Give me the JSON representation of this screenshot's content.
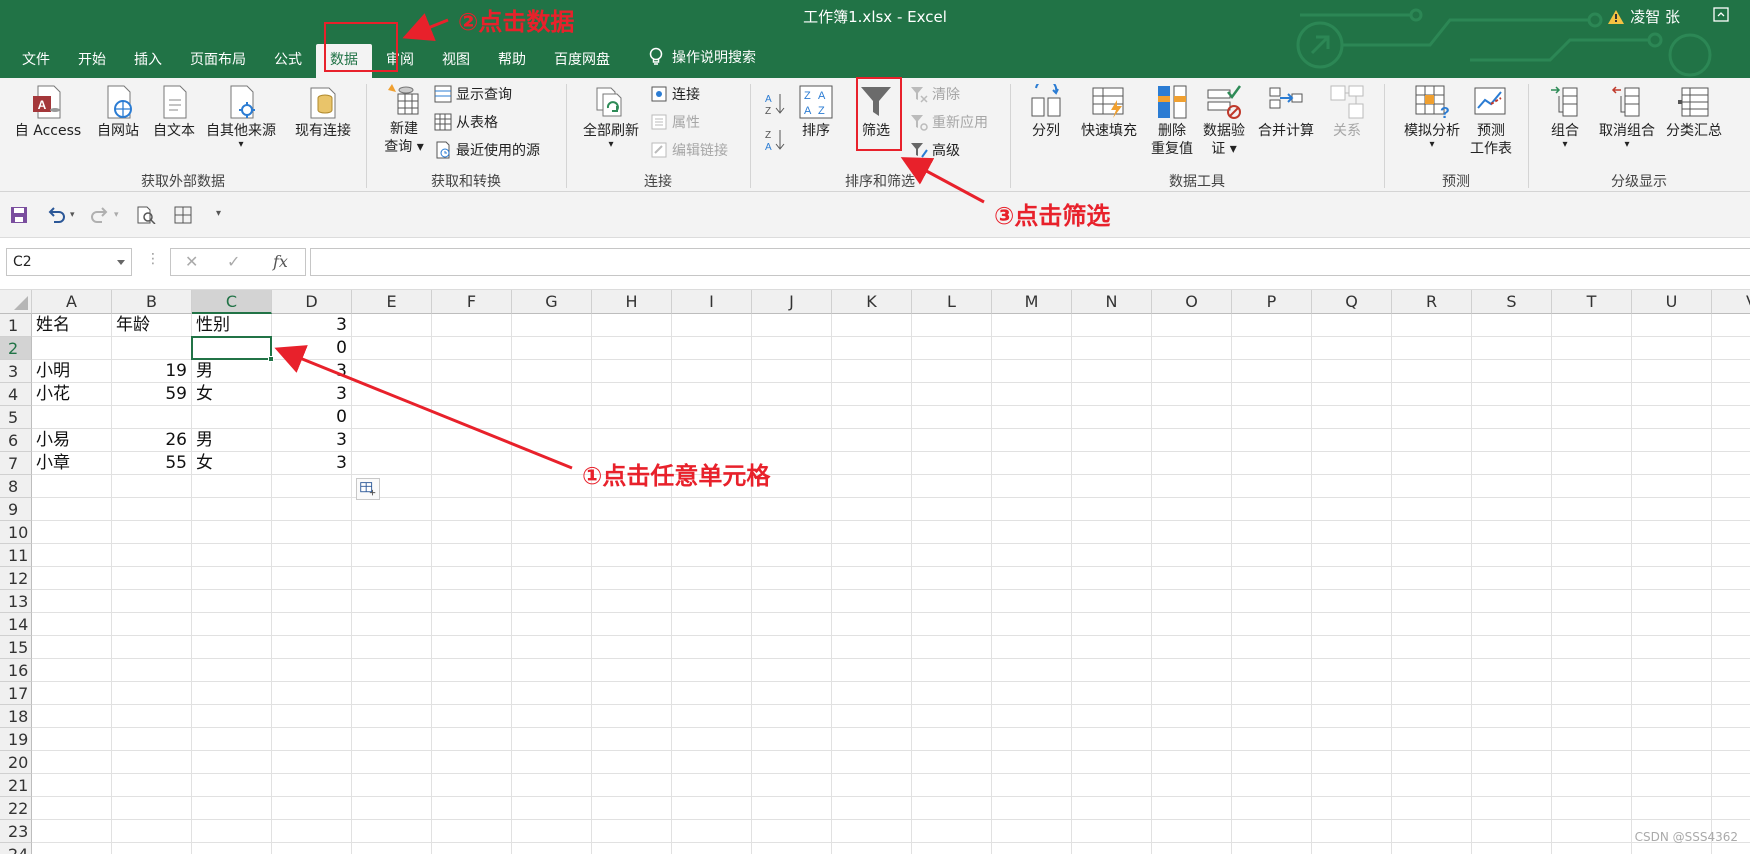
{
  "window": {
    "title": "工作簿1.xlsx  -  Excel",
    "user": "凌智 张"
  },
  "tabs": [
    {
      "label": "文件"
    },
    {
      "label": "开始"
    },
    {
      "label": "插入"
    },
    {
      "label": "页面布局"
    },
    {
      "label": "公式"
    },
    {
      "label": "数据",
      "active": true
    },
    {
      "label": "审阅"
    },
    {
      "label": "视图"
    },
    {
      "label": "帮助"
    },
    {
      "label": "百度网盘"
    }
  ],
  "tell_me": "操作说明搜索",
  "ribbon": {
    "groups": {
      "get_external": "获取外部数据",
      "get_transform": "获取和转换",
      "connections": "连接",
      "sort_filter": "排序和筛选",
      "data_tools": "数据工具",
      "forecast": "预测",
      "outline": "分级显示"
    },
    "buttons": {
      "from_access": "自 Access",
      "from_web": "自网站",
      "from_text": "自文本",
      "from_other": "自其他来源",
      "existing_conn": "现有连接",
      "new_query_1": "新建",
      "new_query_2": "查询",
      "show_queries": "显示查询",
      "from_table": "从表格",
      "recent_sources": "最近使用的源",
      "refresh_all": "全部刷新",
      "connections": "连接",
      "properties": "属性",
      "edit_links": "编辑链接",
      "sort": "排序",
      "filter": "筛选",
      "clear": "清除",
      "reapply": "重新应用",
      "advanced": "高级",
      "text_to_columns": "分列",
      "flash_fill": "快速填充",
      "remove_dup_1": "删除",
      "remove_dup_2": "重复值",
      "validation_1": "数据验",
      "validation_2": "证",
      "consolidate": "合并计算",
      "relationships": "关系",
      "what_if": "模拟分析",
      "forecast_1": "预测",
      "forecast_2": "工作表",
      "group": "组合",
      "ungroup": "取消组合",
      "subtotal": "分类汇总"
    }
  },
  "formula_bar": {
    "name_box": "C2",
    "fx": "fx",
    "formula": ""
  },
  "columns": [
    "A",
    "B",
    "C",
    "D",
    "E",
    "F",
    "G",
    "H",
    "I",
    "J",
    "K",
    "L",
    "M",
    "N",
    "O",
    "P",
    "Q",
    "R",
    "S",
    "T",
    "U",
    "V"
  ],
  "rows": [
    "1",
    "2",
    "3",
    "4",
    "5",
    "6",
    "7",
    "8",
    "9",
    "10",
    "11",
    "12",
    "13",
    "14",
    "15",
    "16",
    "17",
    "18",
    "19",
    "20",
    "21",
    "22",
    "23",
    "24"
  ],
  "cells": [
    [
      "姓名",
      "年龄",
      "性别",
      "3"
    ],
    [
      "",
      "",
      "",
      "0"
    ],
    [
      "小明",
      "19",
      "男",
      "3"
    ],
    [
      "小花",
      "59",
      "女",
      "3"
    ],
    [
      "",
      "",
      "",
      "0"
    ],
    [
      "小易",
      "26",
      "男",
      "3"
    ],
    [
      "小章",
      "55",
      "女",
      "3"
    ]
  ],
  "annotations": {
    "step1": "①点击任意单元格",
    "step2": "②点击数据",
    "step3": "③点击筛选"
  },
  "watermark": "CSDN @SSS4362",
  "colors": {
    "excel_green": "#217346",
    "annotation_red": "#e8212b"
  }
}
